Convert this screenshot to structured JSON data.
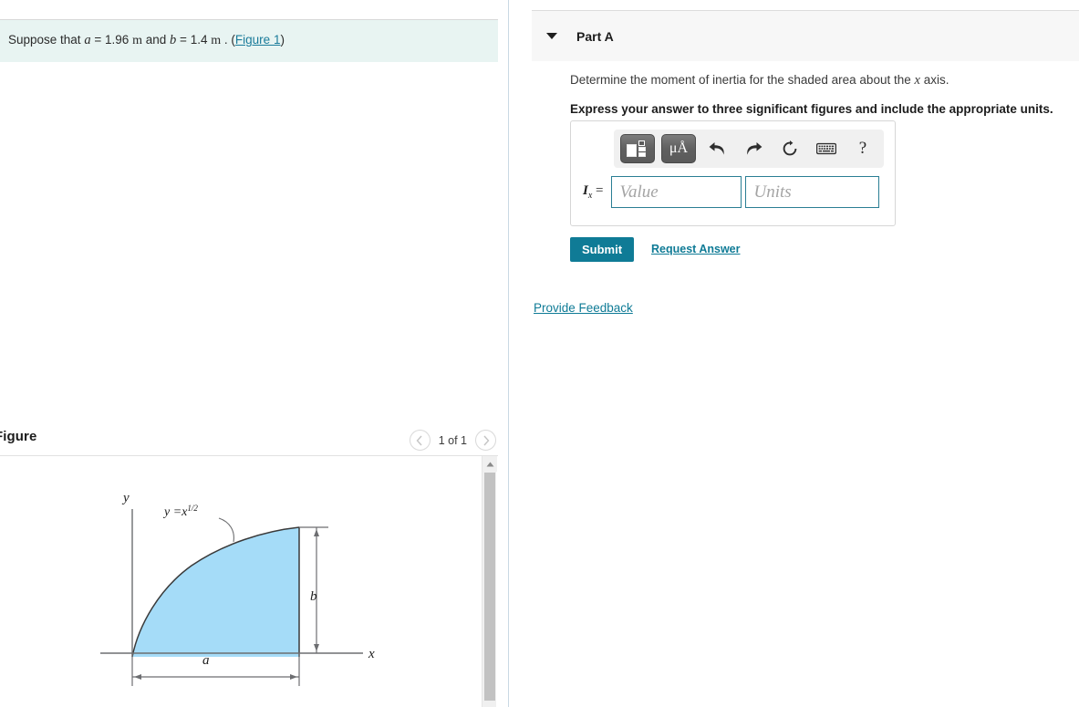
{
  "given": {
    "prefix": "Suppose that",
    "var_a": "a",
    "eq1": "=",
    "val_a": "1.96",
    "unit_a": "m",
    "and": "and",
    "var_b": "b",
    "eq2": "=",
    "val_b": "1.4",
    "unit_b": "m",
    "period": ".",
    "paren_open": "(",
    "figure_link": "Figure 1",
    "paren_close": ")"
  },
  "figure": {
    "title": "Figure",
    "nav": {
      "prev_icon": "chevron-left-icon",
      "count_label": "1 of 1",
      "next_icon": "chevron-right-icon"
    },
    "diagram": {
      "y_axis_label": "y",
      "x_axis_label": "x",
      "curve_label": "y = x",
      "curve_exponent": "1/2",
      "height_label": "b",
      "width_label": "a",
      "fill_color": "#a5dcf8",
      "line_color": "#58595b"
    },
    "scrollbar": {
      "up_arrow_icon": "triangle-up-icon"
    }
  },
  "part": {
    "caret_icon": "caret-down-icon",
    "label": "Part A",
    "prompt_before": "Determine the moment of inertia for the shaded area about the",
    "prompt_var": "x",
    "prompt_after": "axis.",
    "instruction": "Express your answer to three significant figures and include the appropriate units."
  },
  "answer": {
    "toolbar": [
      {
        "name": "template-button",
        "icon": "template-blocks-icon",
        "label": ""
      },
      {
        "name": "units-button",
        "icon": "mu-angstrom-icon",
        "label": "μÅ"
      },
      {
        "name": "undo-button",
        "icon": "undo-arrow-icon",
        "label": "↶"
      },
      {
        "name": "redo-button",
        "icon": "redo-arrow-icon",
        "label": "↷"
      },
      {
        "name": "reset-button",
        "icon": "reset-circular-arrow-icon",
        "label": "↺"
      },
      {
        "name": "keyboard-button",
        "icon": "keyboard-icon",
        "label": "⌨"
      },
      {
        "name": "help-button",
        "icon": "question-mark-icon",
        "label": "?"
      }
    ],
    "label_symbol": "I",
    "label_sub": "x",
    "label_equals": "=",
    "value_placeholder": "Value",
    "units_placeholder": "Units",
    "value_current": "",
    "units_current": ""
  },
  "actions": {
    "submit_label": "Submit",
    "request_answer_label": "Request Answer",
    "provide_feedback_label": "Provide Feedback"
  },
  "colors": {
    "accent": "#0f7b96",
    "banner_bg": "#e8f4f2",
    "header_bg": "#f7f7f7",
    "figure_fill": "#a5dcf8"
  }
}
